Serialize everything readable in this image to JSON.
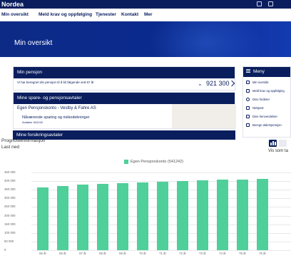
{
  "header": {
    "brand": "Nordea"
  },
  "nav": {
    "items": [
      "Min oversikt",
      "Meld krav og oppfølging",
      "Tjenester",
      "Kontakt",
      "Mer"
    ]
  },
  "hero": {
    "title": "Min oversikt"
  },
  "pension": {
    "title": "Min pensjon",
    "description": "Vi har beregnet din pensjon til å bli følgende ved 67 år",
    "currency": "kr",
    "amount": "921 300"
  },
  "savings": {
    "title": "Mine spare- og pensjonsavtaler",
    "account": "Egen Pensjonskonto - Vestby & Fahre AS",
    "sub_title": "Nåværende sparing og risikodekninger",
    "sub_detail": "Avtalenr 541242"
  },
  "insurance": {
    "title": "Mine forsikringsavtaler"
  },
  "menu": {
    "title": "Meny",
    "items": [
      {
        "label": "Min oversikt",
        "icon": "home-icon"
      },
      {
        "label": "Meld krav og oppfølging",
        "icon": "claim-icon"
      },
      {
        "label": "Dine fordeler",
        "icon": "heart-icon"
      },
      {
        "label": "Nettpost",
        "icon": "mail-icon"
      },
      {
        "label": "Dine henvendelser",
        "icon": "chat-icon"
      },
      {
        "label": "Beregn alderspensjon",
        "icon": "calculator-icon"
      }
    ]
  },
  "forecast": {
    "title": "Prognoseinformasjon",
    "subtitle": "Last ned",
    "view_label": "Vis som ta"
  },
  "chart_data": {
    "type": "bar",
    "series": [
      {
        "name": "Egen Pensjonskonto (541242)",
        "color": "#4fcf9a"
      }
    ],
    "categories": [
      "65 år",
      "66 år",
      "67 år",
      "68 år",
      "69 år",
      "70 år",
      "71 år",
      "72 år",
      "73 år",
      "74 år",
      "75 år",
      "76 år"
    ],
    "values": [
      365000,
      372000,
      378000,
      383000,
      388000,
      394000,
      398000,
      401000,
      404000,
      407000,
      410000,
      412000
    ],
    "yticks": [
      "450 000",
      "400 000",
      "350 000",
      "300 000",
      "250 000",
      "200 000",
      "150 000",
      "100 000",
      "50 000",
      "0"
    ],
    "ylim": [
      0,
      450000
    ],
    "grid": true,
    "legend": "top-center"
  }
}
